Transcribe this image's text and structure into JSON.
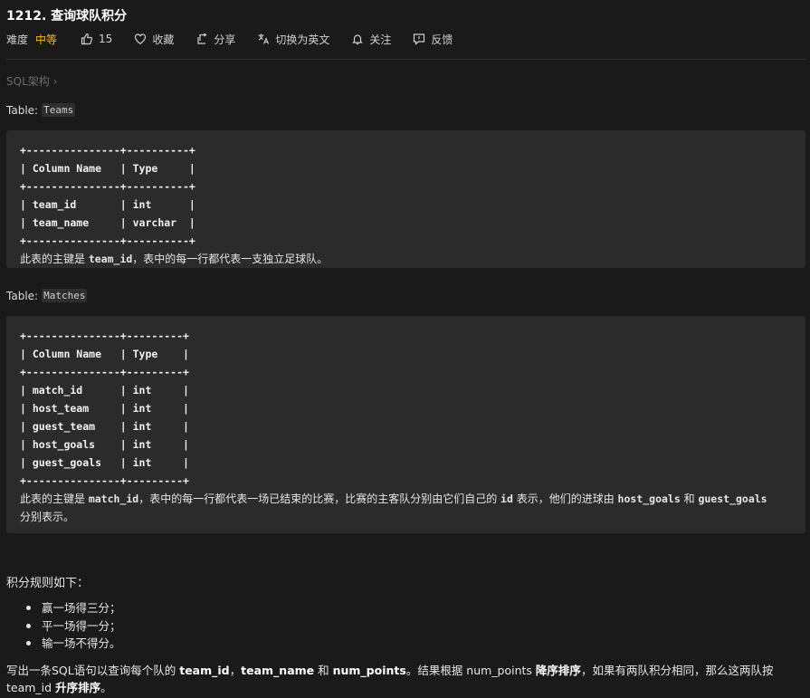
{
  "problem": {
    "title": "1212. 查询球队积分",
    "difficulty_label": "难度",
    "difficulty": "中等",
    "likes": "15",
    "favorite": "收藏",
    "share": "分享",
    "switch_lang": "切换为英文",
    "follow": "关注",
    "feedback": "反馈",
    "breadcrumb": "SQL架构",
    "colors": {
      "difficulty": "#ffb800",
      "background": "#1a1a1a",
      "code_bg": "#2b2b2b"
    }
  },
  "teams": {
    "label": "Table:",
    "name": "Teams",
    "schema": "+---------------+----------+\n| Column Name   | Type     |\n+---------------+----------+\n| team_id       | int      |\n| team_name     | varchar  |\n+---------------+----------+",
    "desc_1": "此表的主键是 ",
    "desc_key": "team_id",
    "desc_2": "，表中的每一行都代表一支独立足球队。"
  },
  "matches": {
    "label": "Table:",
    "name": "Matches",
    "schema": "+---------------+---------+\n| Column Name   | Type    |\n+---------------+---------+\n| match_id      | int     |\n| host_team     | int     |\n| guest_team    | int     |\n| host_goals    | int     |\n| guest_goals   | int     |\n+---------------+---------+",
    "desc_1": "此表的主键是 ",
    "desc_key": "match_id",
    "desc_2": "，表中的每一行都代表一场已结束的比赛，比赛的主客队分别由它们自己的 ",
    "desc_id": "id",
    "desc_3": " 表示，他们的进球由 ",
    "desc_host": "host_goals",
    "desc_4": " 和 ",
    "desc_guest": "guest_goals",
    "desc_5": " 分别表示。"
  },
  "rules": {
    "title": "积分规则如下：",
    "items": [
      "赢一场得三分；",
      "平一场得一分；",
      "输一场不得分。"
    ]
  },
  "question": {
    "t1": "写出一条SQL语句以查询每个队的 ",
    "b1": "team_id",
    "t2": "，",
    "b2": "team_name",
    "t3": " 和 ",
    "b3": "num_points",
    "t4": "。结果根据 num_points ",
    "b4": "降序排序",
    "t5": "，如果有两队积分相同，那么这两队按 team_id ",
    "b5": "升序排序",
    "t6": "。"
  }
}
